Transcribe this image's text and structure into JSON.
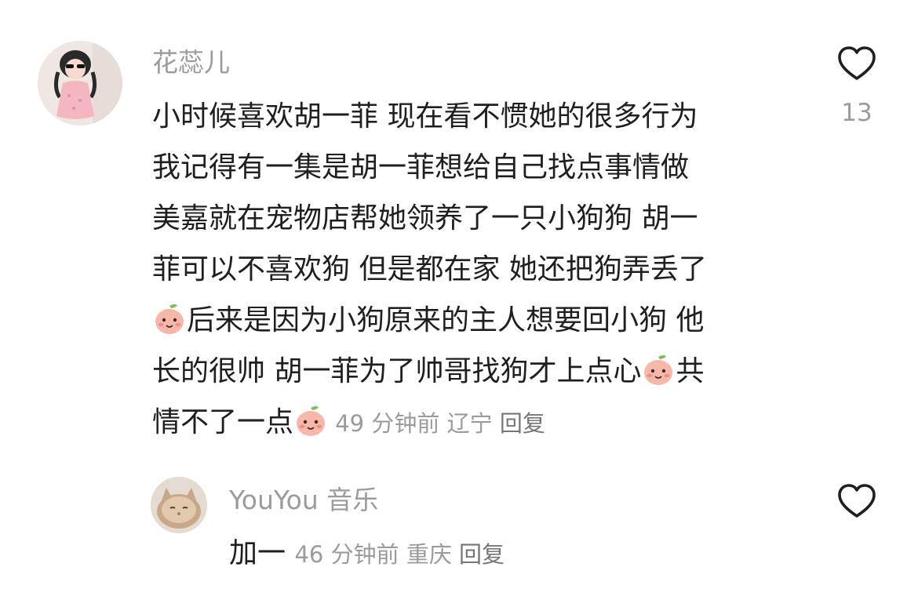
{
  "comment": {
    "username": "花蕊儿",
    "lines": [
      "小时候喜欢胡一菲 现在看不惯她的很多行为",
      "我记得有一集是胡一菲想给自己找点事情做",
      "美嘉就在宠物店帮她领养了一只小狗狗  胡一",
      "菲可以不喜欢狗 但是都在家 她还把狗弄丢了",
      "后来是因为小狗原来的主人想要回小狗 他",
      "长的很帅 胡一菲为了帅哥找狗才上点心",
      "共",
      "情不了一点"
    ],
    "time": "49 分钟前",
    "location": "辽宁",
    "reply_label": "回复",
    "like_count": "13",
    "emoji_name": "peach-face-emoji"
  },
  "reply": {
    "username": "YouYou 音乐",
    "text": "加一",
    "time": "46 分钟前",
    "location": "重庆",
    "reply_label": "回复"
  },
  "colors": {
    "text": "#1f1f1f",
    "meta": "#9b9b9b",
    "emoji_face": "#f7b8aa",
    "emoji_leaf": "#7bbf5a"
  }
}
